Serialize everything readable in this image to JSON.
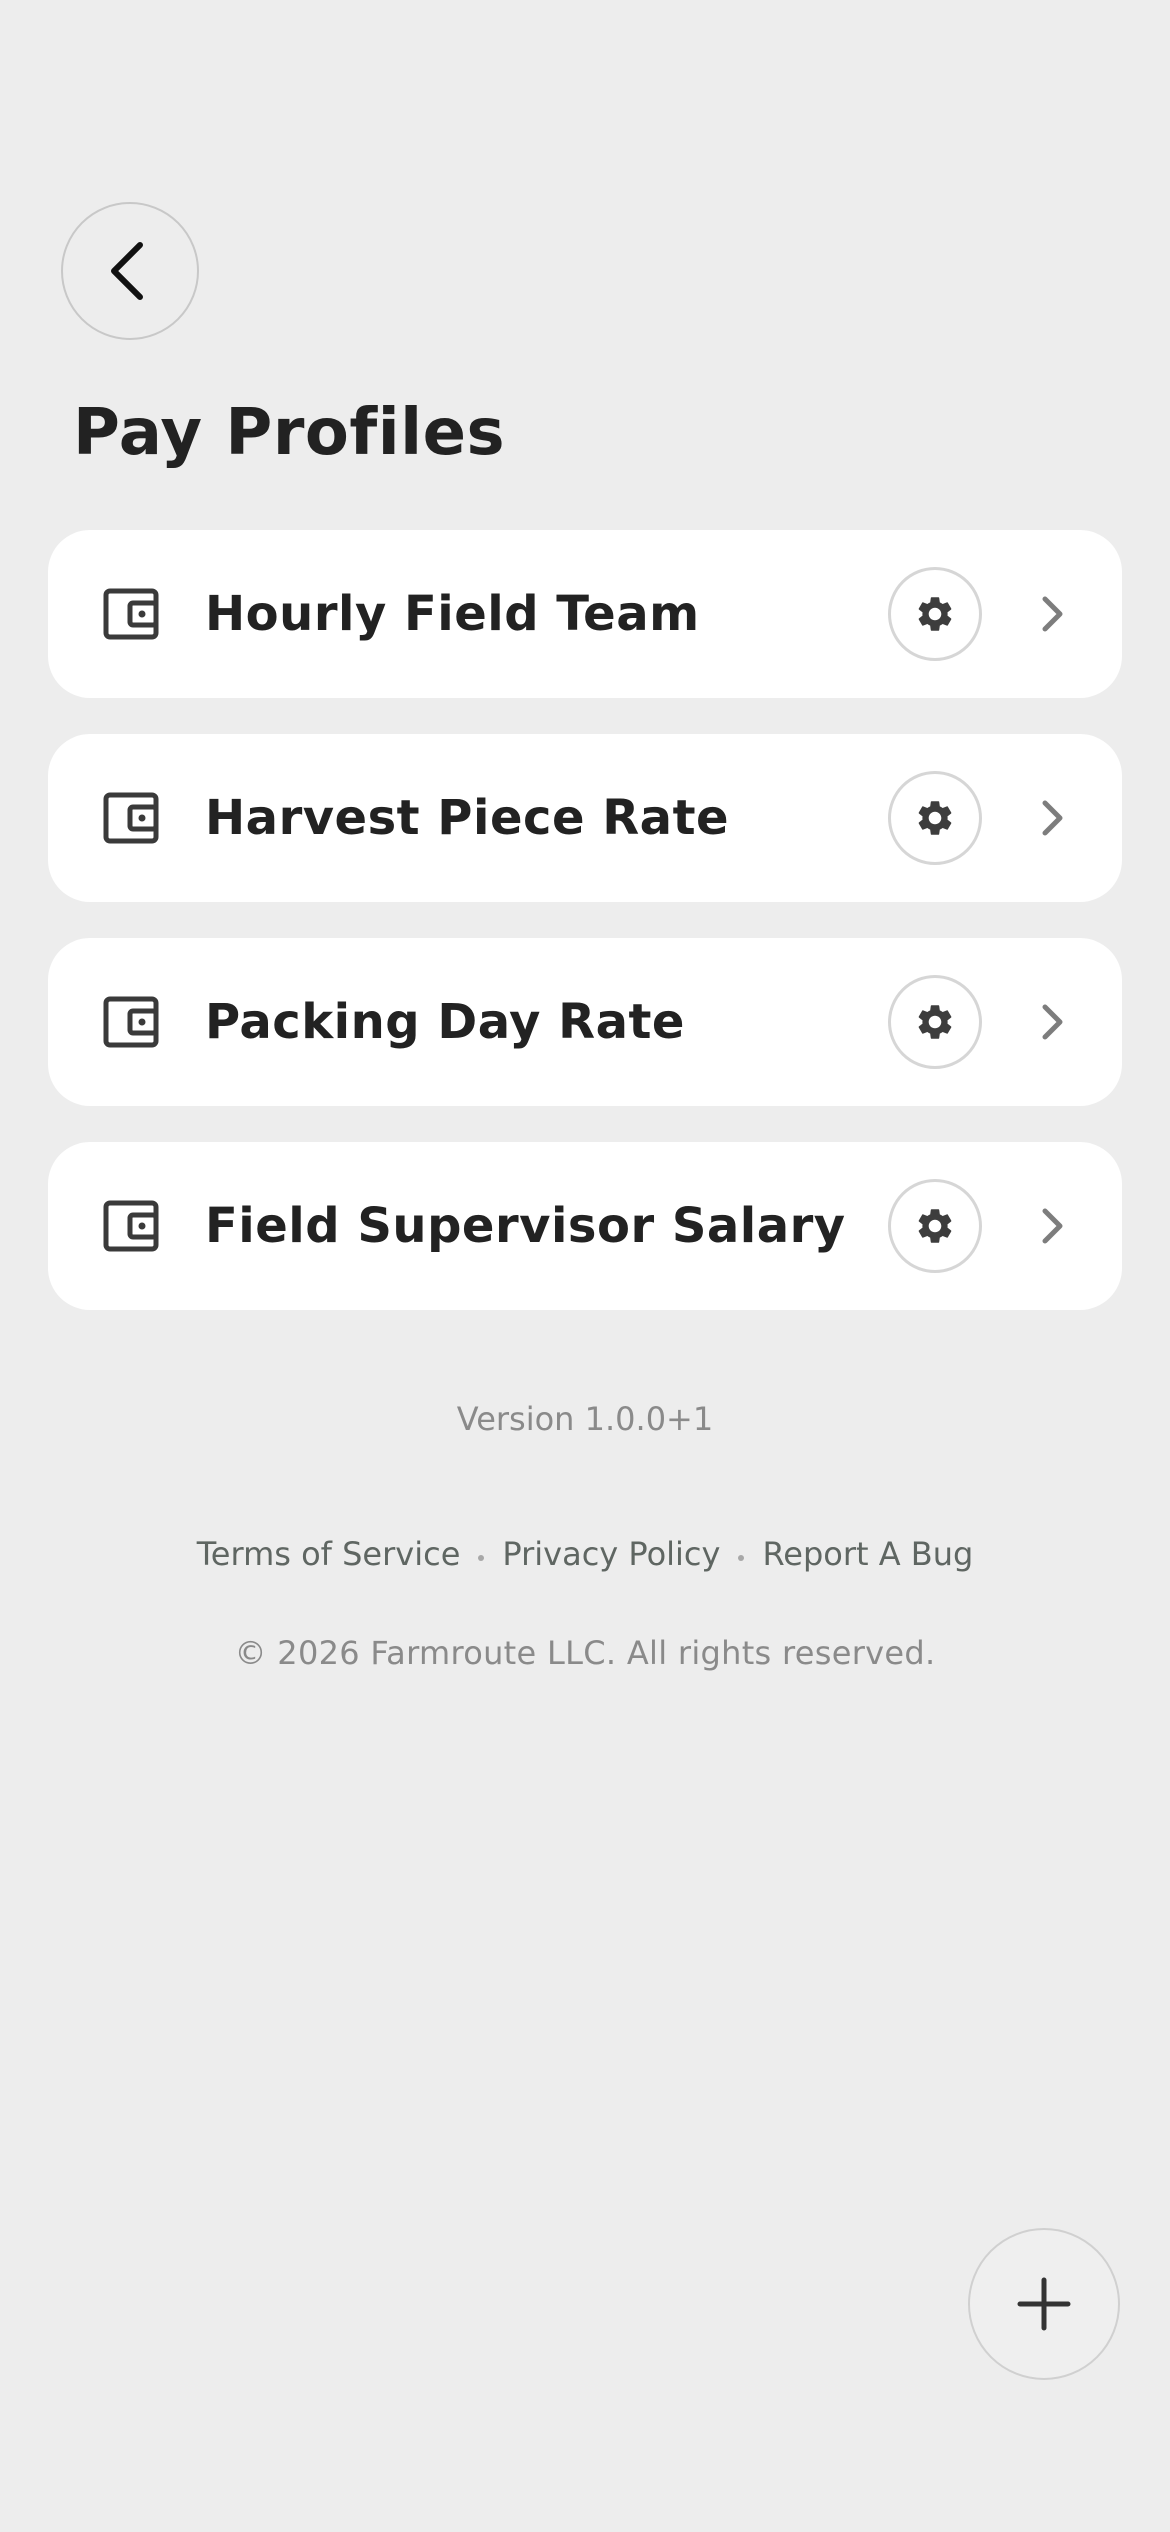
{
  "header": {
    "title": "Pay Profiles",
    "back_icon": "chevron-left-icon"
  },
  "profiles": [
    {
      "name": "Hourly Field Team",
      "icon": "wallet-icon"
    },
    {
      "name": "Harvest Piece Rate",
      "icon": "wallet-icon"
    },
    {
      "name": "Packing Day Rate",
      "icon": "wallet-icon"
    },
    {
      "name": "Field Supervisor Salary",
      "icon": "wallet-icon"
    }
  ],
  "footer": {
    "version": "Version 1.0.0+1",
    "links": [
      "Terms of Service",
      "Privacy Policy",
      "Report A Bug"
    ],
    "copyright": "© 2026 Farmroute LLC. All rights reserved."
  },
  "fab": {
    "icon": "plus-icon"
  },
  "colors": {
    "background": "#ededed",
    "card": "#ffffff",
    "text": "#222222",
    "muted": "#8a8a8a",
    "link": "#5f6662"
  }
}
